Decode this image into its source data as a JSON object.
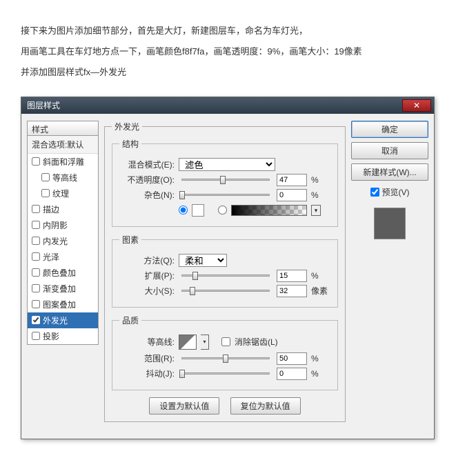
{
  "intro": {
    "l1": "接下来为图片添加细节部分，首先是大灯，新建图层车，命名为车灯光，",
    "l2": "用画笔工具在车灯地方点一下，画笔颜色f8f7fa，画笔透明度：9%，画笔大小：19像素",
    "l3": "并添加图层样式fx—外发光"
  },
  "dialog": {
    "title": "图层样式",
    "styles_header": "样式",
    "blend_options": "混合选项:默认",
    "items": {
      "bevel": "斜面和浮雕",
      "contour": "等高线",
      "texture": "纹理",
      "stroke": "描边",
      "inner_shadow": "内阴影",
      "inner_glow": "内发光",
      "satin": "光泽",
      "color_overlay": "颜色叠加",
      "gradient_overlay": "渐变叠加",
      "pattern_overlay": "图案叠加",
      "outer_glow": "外发光",
      "drop_shadow": "投影"
    },
    "panel_title": "外发光",
    "structure": {
      "legend": "结构",
      "blend_mode_label": "混合模式(E):",
      "blend_mode_value": "滤色",
      "opacity_label": "不透明度(O):",
      "opacity_value": "47",
      "opacity_unit": "%",
      "noise_label": "杂色(N):",
      "noise_value": "0",
      "noise_unit": "%"
    },
    "elements": {
      "legend": "图素",
      "technique_label": "方法(Q):",
      "technique_value": "柔和",
      "spread_label": "扩展(P):",
      "spread_value": "15",
      "spread_unit": "%",
      "size_label": "大小(S):",
      "size_value": "32",
      "size_unit": "像素"
    },
    "quality": {
      "legend": "品质",
      "contour_label": "等高线:",
      "anti_alias": "消除锯齿(L)",
      "range_label": "范围(R):",
      "range_value": "50",
      "range_unit": "%",
      "jitter_label": "抖动(J):",
      "jitter_value": "0",
      "jitter_unit": "%"
    },
    "make_default": "设置为默认值",
    "reset_default": "复位为默认值",
    "ok": "确定",
    "cancel": "取消",
    "new_style": "新建样式(W)...",
    "preview": "预览(V)"
  }
}
